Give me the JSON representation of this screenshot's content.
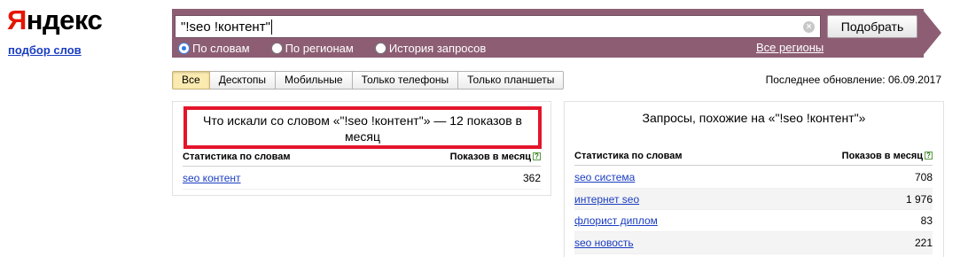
{
  "logo": {
    "first": "Я",
    "rest": "ндекс"
  },
  "service_link": "подбор слов",
  "search": {
    "value": "\"!seo !контент\"",
    "clear": "×",
    "submit": "Подобрать"
  },
  "radios": [
    {
      "label": "По словам",
      "checked": true
    },
    {
      "label": "По регионам",
      "checked": false
    },
    {
      "label": "История запросов",
      "checked": false
    }
  ],
  "regions_link": "Все регионы",
  "tabs": [
    {
      "label": "Все",
      "active": true
    },
    {
      "label": "Десктопы"
    },
    {
      "label": "Мобильные"
    },
    {
      "label": "Только телефоны"
    },
    {
      "label": "Только планшеты"
    }
  ],
  "updated": "Последнее обновление: 06.09.2017",
  "left_panel": {
    "title": "Что искали со словом «\"!seo !контент\"» — 12 показов в месяц",
    "col_keyword": "Статистика по словам",
    "col_count": "Показов в месяц",
    "help": "?",
    "rows": [
      {
        "keyword": "seo контент",
        "count": "362"
      }
    ]
  },
  "right_panel": {
    "title": "Запросы, похожие на «\"!seo !контент\"»",
    "col_keyword": "Статистика по словам",
    "col_count": "Показов в месяц",
    "help": "?",
    "rows": [
      {
        "keyword": "seo система",
        "count": "708"
      },
      {
        "keyword": "интернет seo",
        "count": "1 976"
      },
      {
        "keyword": "флорист диплом",
        "count": "83"
      },
      {
        "keyword": "seo новость",
        "count": "221"
      }
    ]
  },
  "colors": {
    "band": "#8d5e73",
    "highlight": "#e3152b",
    "link": "#1a3dc1",
    "active_tab": "#fcebb0"
  }
}
